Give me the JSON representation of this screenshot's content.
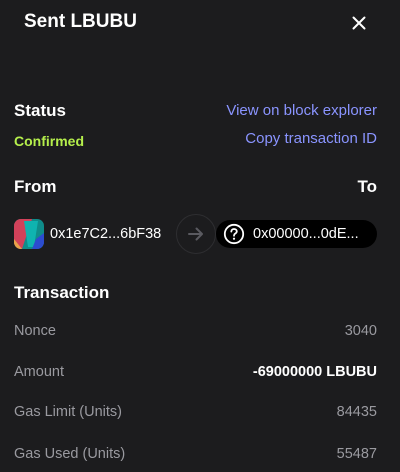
{
  "header": {
    "title": "Sent LBUBU",
    "close_icon": "close-icon"
  },
  "status": {
    "label": "Status",
    "value": "Confirmed",
    "value_color": "#b5ef4c",
    "view_explorer": "View on block explorer",
    "copy_tx_id": "Copy transaction ID"
  },
  "transfer": {
    "from_label": "From",
    "to_label": "To",
    "from_address": "0x1e7C2...6bF38",
    "to_address": "0x00000...0dE...",
    "arrow_icon": "arrow-right-icon",
    "to_icon": "question-circle-icon"
  },
  "transaction": {
    "title": "Transaction",
    "rows": [
      {
        "label": "Nonce",
        "value": "3040"
      },
      {
        "label": "Amount",
        "value": "-69000000 LBUBU"
      },
      {
        "label": "Gas Limit (Units)",
        "value": "84435"
      },
      {
        "label": "Gas Used (Units)",
        "value": "55487"
      }
    ]
  },
  "colors": {
    "background": "#1c1c1e",
    "link": "#8a94ff",
    "muted": "#9a9aa0"
  }
}
